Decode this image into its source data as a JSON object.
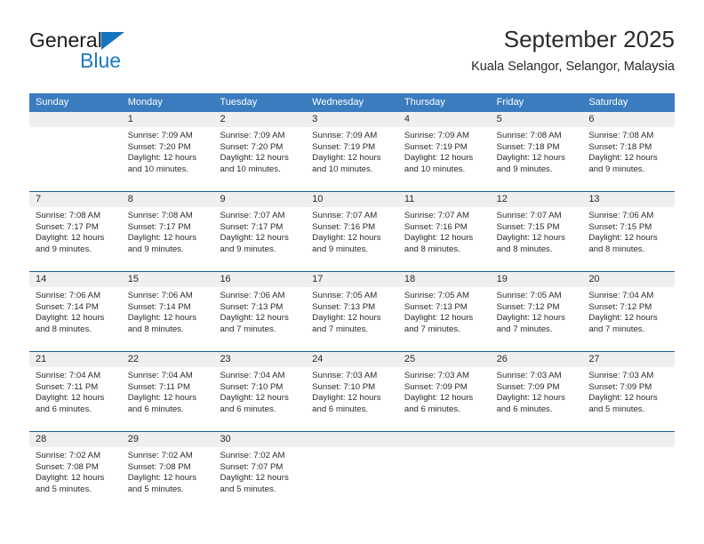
{
  "brand": {
    "name_top": "General",
    "name_bottom": "Blue",
    "triangle_color": "#1574bf",
    "blue_text_color": "#1a7ac4"
  },
  "header": {
    "title": "September 2025",
    "subtitle": "Kuala Selangor, Selangor, Malaysia"
  },
  "colors": {
    "header_bar": "#3a7cbe",
    "daynum_band": "#efefef",
    "week_separator": "#1c5d9e",
    "text": "#2b2b2b"
  },
  "weekdays": [
    "Sunday",
    "Monday",
    "Tuesday",
    "Wednesday",
    "Thursday",
    "Friday",
    "Saturday"
  ],
  "weeks": [
    {
      "days": [
        {
          "num": "",
          "sunrise": "",
          "sunset": "",
          "daylight": ""
        },
        {
          "num": "1",
          "sunrise": "Sunrise: 7:09 AM",
          "sunset": "Sunset: 7:20 PM",
          "daylight": "Daylight: 12 hours and 10 minutes."
        },
        {
          "num": "2",
          "sunrise": "Sunrise: 7:09 AM",
          "sunset": "Sunset: 7:20 PM",
          "daylight": "Daylight: 12 hours and 10 minutes."
        },
        {
          "num": "3",
          "sunrise": "Sunrise: 7:09 AM",
          "sunset": "Sunset: 7:19 PM",
          "daylight": "Daylight: 12 hours and 10 minutes."
        },
        {
          "num": "4",
          "sunrise": "Sunrise: 7:09 AM",
          "sunset": "Sunset: 7:19 PM",
          "daylight": "Daylight: 12 hours and 10 minutes."
        },
        {
          "num": "5",
          "sunrise": "Sunrise: 7:08 AM",
          "sunset": "Sunset: 7:18 PM",
          "daylight": "Daylight: 12 hours and 9 minutes."
        },
        {
          "num": "6",
          "sunrise": "Sunrise: 7:08 AM",
          "sunset": "Sunset: 7:18 PM",
          "daylight": "Daylight: 12 hours and 9 minutes."
        }
      ]
    },
    {
      "days": [
        {
          "num": "7",
          "sunrise": "Sunrise: 7:08 AM",
          "sunset": "Sunset: 7:17 PM",
          "daylight": "Daylight: 12 hours and 9 minutes."
        },
        {
          "num": "8",
          "sunrise": "Sunrise: 7:08 AM",
          "sunset": "Sunset: 7:17 PM",
          "daylight": "Daylight: 12 hours and 9 minutes."
        },
        {
          "num": "9",
          "sunrise": "Sunrise: 7:07 AM",
          "sunset": "Sunset: 7:17 PM",
          "daylight": "Daylight: 12 hours and 9 minutes."
        },
        {
          "num": "10",
          "sunrise": "Sunrise: 7:07 AM",
          "sunset": "Sunset: 7:16 PM",
          "daylight": "Daylight: 12 hours and 9 minutes."
        },
        {
          "num": "11",
          "sunrise": "Sunrise: 7:07 AM",
          "sunset": "Sunset: 7:16 PM",
          "daylight": "Daylight: 12 hours and 8 minutes."
        },
        {
          "num": "12",
          "sunrise": "Sunrise: 7:07 AM",
          "sunset": "Sunset: 7:15 PM",
          "daylight": "Daylight: 12 hours and 8 minutes."
        },
        {
          "num": "13",
          "sunrise": "Sunrise: 7:06 AM",
          "sunset": "Sunset: 7:15 PM",
          "daylight": "Daylight: 12 hours and 8 minutes."
        }
      ]
    },
    {
      "days": [
        {
          "num": "14",
          "sunrise": "Sunrise: 7:06 AM",
          "sunset": "Sunset: 7:14 PM",
          "daylight": "Daylight: 12 hours and 8 minutes."
        },
        {
          "num": "15",
          "sunrise": "Sunrise: 7:06 AM",
          "sunset": "Sunset: 7:14 PM",
          "daylight": "Daylight: 12 hours and 8 minutes."
        },
        {
          "num": "16",
          "sunrise": "Sunrise: 7:06 AM",
          "sunset": "Sunset: 7:13 PM",
          "daylight": "Daylight: 12 hours and 7 minutes."
        },
        {
          "num": "17",
          "sunrise": "Sunrise: 7:05 AM",
          "sunset": "Sunset: 7:13 PM",
          "daylight": "Daylight: 12 hours and 7 minutes."
        },
        {
          "num": "18",
          "sunrise": "Sunrise: 7:05 AM",
          "sunset": "Sunset: 7:13 PM",
          "daylight": "Daylight: 12 hours and 7 minutes."
        },
        {
          "num": "19",
          "sunrise": "Sunrise: 7:05 AM",
          "sunset": "Sunset: 7:12 PM",
          "daylight": "Daylight: 12 hours and 7 minutes."
        },
        {
          "num": "20",
          "sunrise": "Sunrise: 7:04 AM",
          "sunset": "Sunset: 7:12 PM",
          "daylight": "Daylight: 12 hours and 7 minutes."
        }
      ]
    },
    {
      "days": [
        {
          "num": "21",
          "sunrise": "Sunrise: 7:04 AM",
          "sunset": "Sunset: 7:11 PM",
          "daylight": "Daylight: 12 hours and 6 minutes."
        },
        {
          "num": "22",
          "sunrise": "Sunrise: 7:04 AM",
          "sunset": "Sunset: 7:11 PM",
          "daylight": "Daylight: 12 hours and 6 minutes."
        },
        {
          "num": "23",
          "sunrise": "Sunrise: 7:04 AM",
          "sunset": "Sunset: 7:10 PM",
          "daylight": "Daylight: 12 hours and 6 minutes."
        },
        {
          "num": "24",
          "sunrise": "Sunrise: 7:03 AM",
          "sunset": "Sunset: 7:10 PM",
          "daylight": "Daylight: 12 hours and 6 minutes."
        },
        {
          "num": "25",
          "sunrise": "Sunrise: 7:03 AM",
          "sunset": "Sunset: 7:09 PM",
          "daylight": "Daylight: 12 hours and 6 minutes."
        },
        {
          "num": "26",
          "sunrise": "Sunrise: 7:03 AM",
          "sunset": "Sunset: 7:09 PM",
          "daylight": "Daylight: 12 hours and 6 minutes."
        },
        {
          "num": "27",
          "sunrise": "Sunrise: 7:03 AM",
          "sunset": "Sunset: 7:09 PM",
          "daylight": "Daylight: 12 hours and 5 minutes."
        }
      ]
    },
    {
      "days": [
        {
          "num": "28",
          "sunrise": "Sunrise: 7:02 AM",
          "sunset": "Sunset: 7:08 PM",
          "daylight": "Daylight: 12 hours and 5 minutes."
        },
        {
          "num": "29",
          "sunrise": "Sunrise: 7:02 AM",
          "sunset": "Sunset: 7:08 PM",
          "daylight": "Daylight: 12 hours and 5 minutes."
        },
        {
          "num": "30",
          "sunrise": "Sunrise: 7:02 AM",
          "sunset": "Sunset: 7:07 PM",
          "daylight": "Daylight: 12 hours and 5 minutes."
        },
        {
          "num": "",
          "sunrise": "",
          "sunset": "",
          "daylight": ""
        },
        {
          "num": "",
          "sunrise": "",
          "sunset": "",
          "daylight": ""
        },
        {
          "num": "",
          "sunrise": "",
          "sunset": "",
          "daylight": ""
        },
        {
          "num": "",
          "sunrise": "",
          "sunset": "",
          "daylight": ""
        }
      ]
    }
  ]
}
